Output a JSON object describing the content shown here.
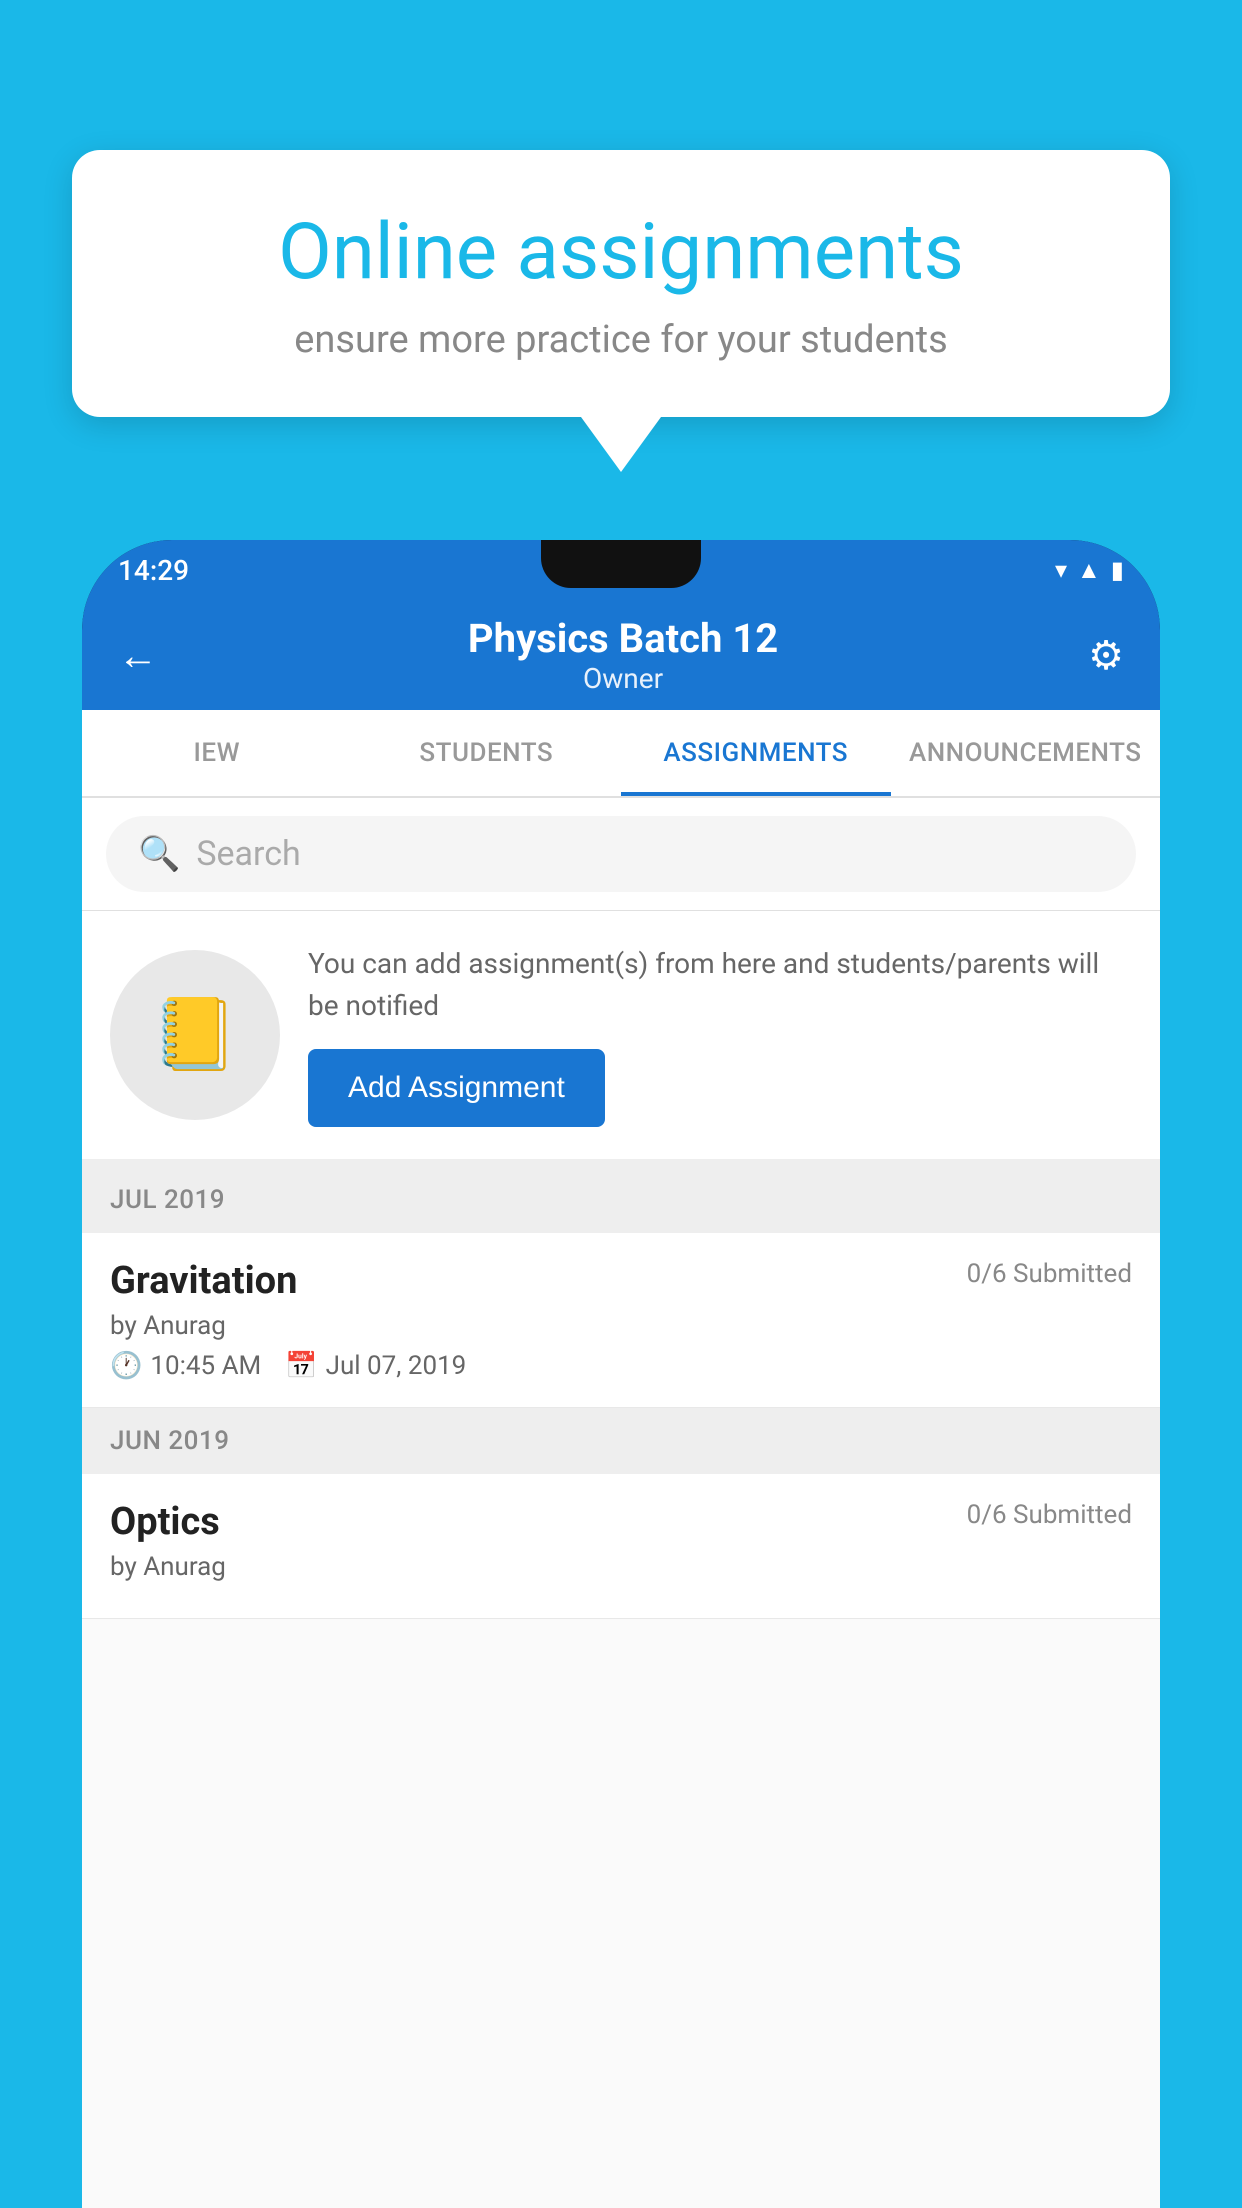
{
  "background_color": "#1ab8e8",
  "speech_bubble": {
    "title": "Online assignments",
    "subtitle": "ensure more practice for your students"
  },
  "status_bar": {
    "time": "14:29",
    "icons": [
      "wifi",
      "signal",
      "battery"
    ]
  },
  "app_bar": {
    "title": "Physics Batch 12",
    "subtitle": "Owner",
    "back_label": "←",
    "settings_label": "⚙"
  },
  "tabs": [
    {
      "label": "IEW",
      "active": false
    },
    {
      "label": "STUDENTS",
      "active": false
    },
    {
      "label": "ASSIGNMENTS",
      "active": true
    },
    {
      "label": "ANNOUNCEMENTS",
      "active": false
    }
  ],
  "search": {
    "placeholder": "Search"
  },
  "add_assignment_section": {
    "description": "You can add assignment(s) from here and students/parents will be notified",
    "button_label": "Add Assignment",
    "icon": "📓"
  },
  "months": [
    {
      "label": "JUL 2019",
      "assignments": [
        {
          "name": "Gravitation",
          "submitted": "0/6 Submitted",
          "author": "by Anurag",
          "time": "10:45 AM",
          "date": "Jul 07, 2019"
        }
      ]
    },
    {
      "label": "JUN 2019",
      "assignments": [
        {
          "name": "Optics",
          "submitted": "0/6 Submitted",
          "author": "by Anurag",
          "time": "",
          "date": ""
        }
      ]
    }
  ]
}
